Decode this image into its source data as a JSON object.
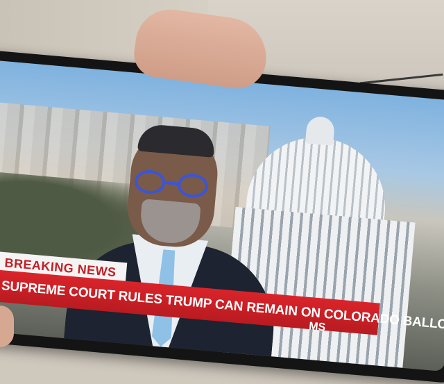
{
  "scene": {
    "type": "phone-photo-of-tv-broadcast"
  },
  "broadcast": {
    "tag": "BREAKING NEWS",
    "headline": "SUPREME COURT RULES TRUMP CAN REMAIN ON COLORADO BALLOT",
    "network_logo": "MS"
  },
  "colors": {
    "lower_third": "#c21f24",
    "breaking_bg": "#f4f4f4",
    "glasses": "#3a55d8"
  }
}
